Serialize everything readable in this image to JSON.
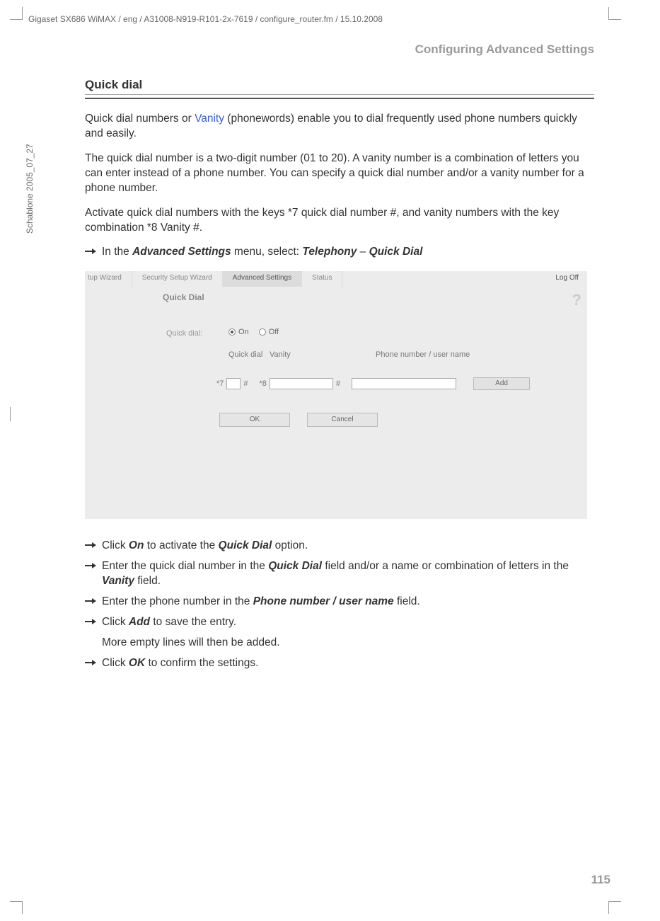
{
  "header_doc_path": "Gigaset SX686 WiMAX / eng / A31008-N919-R101-2x-7619 / configure_router.fm / 15.10.2008",
  "side_template": "Schablone 2005_07_27",
  "section_title": "Configuring Advanced Settings",
  "subsection": "Quick dial",
  "p1_a": "Quick dial numbers or ",
  "p1_link": "Vanity",
  "p1_b": " (phonewords) enable you to dial frequently used phone numbers quickly and easily.",
  "p2": "The quick dial number is a two-digit number (01 to 20). A vanity number is a combination of letters you can enter instead of a phone number. You can specify a quick dial number and/or a vanity number for a phone number.",
  "p3": "Activate quick dial numbers with the keys *7 quick dial number #, and vanity numbers with the key combination *8 Vanity #.",
  "inst1_a": "In the ",
  "inst1_b": "Advanced Settings",
  "inst1_c": " menu, select: ",
  "inst1_d": "Telephony",
  "inst1_dash": " – ",
  "inst1_e": "Quick Dial",
  "panel": {
    "tabs": {
      "t1": "tup Wizard",
      "t2": "Security Setup Wizard",
      "t3": "Advanced Settings",
      "t4": "Status"
    },
    "logoff": "Log Off",
    "heading": "Quick Dial",
    "help": "?",
    "label_quick_dial": "Quick dial:",
    "radio_on": "On",
    "radio_off": "Off",
    "col_qd": "Quick dial",
    "col_van": "Vanity",
    "col_phone": "Phone number / user name",
    "prefix_7": "*7",
    "hash1": "#",
    "prefix_8": "*8",
    "hash2": "#",
    "add": "Add",
    "ok": "OK",
    "cancel": "Cancel"
  },
  "b1_a": "Click ",
  "b1_b": "On",
  "b1_c": " to activate the ",
  "b1_d": "Quick Dial",
  "b1_e": " option.",
  "b2_a": "Enter the quick dial number in the ",
  "b2_b": "Quick Dial",
  "b2_c": " field and/or a name or combination of letters in the ",
  "b2_d": "Vanity",
  "b2_e": " field.",
  "b3_a": "Enter the phone number in the ",
  "b3_b": "Phone number / user name",
  "b3_c": " field.",
  "b4_a": "Click ",
  "b4_b": "Add",
  "b4_c": " to save the entry.",
  "b4_follow": "More empty lines will then be added.",
  "b5_a": "Click ",
  "b5_b": "OK",
  "b5_c": " to confirm the settings.",
  "page_number": "115"
}
